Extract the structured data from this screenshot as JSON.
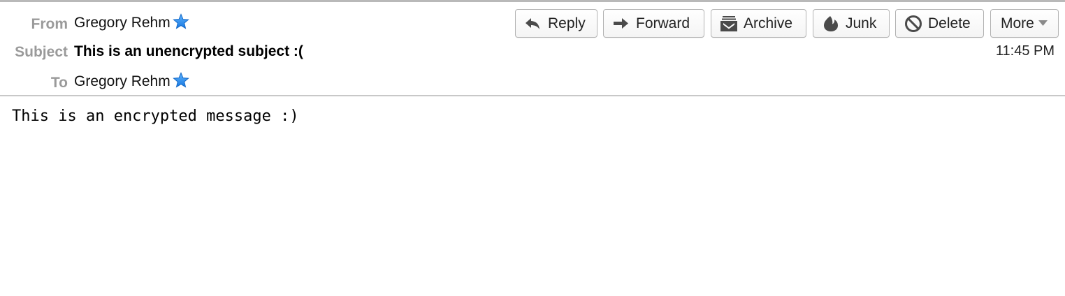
{
  "header": {
    "from": {
      "label": "From",
      "value": "Gregory Rehm"
    },
    "subject": {
      "label": "Subject",
      "value": "This is an unencrypted subject :("
    },
    "to": {
      "label": "To",
      "value": "Gregory Rehm"
    },
    "time": "11:45 PM",
    "star_icon": "star-icon",
    "star_color": "#2a8ff0"
  },
  "toolbar": {
    "reply_label": "Reply",
    "forward_label": "Forward",
    "archive_label": "Archive",
    "junk_label": "Junk",
    "delete_label": "Delete",
    "more_label": "More",
    "icons": [
      "reply-icon",
      "forward-icon",
      "archive-icon",
      "junk-icon",
      "delete-icon",
      "chevron-down-icon"
    ]
  },
  "message": {
    "body": "This is an encrypted message :)"
  }
}
